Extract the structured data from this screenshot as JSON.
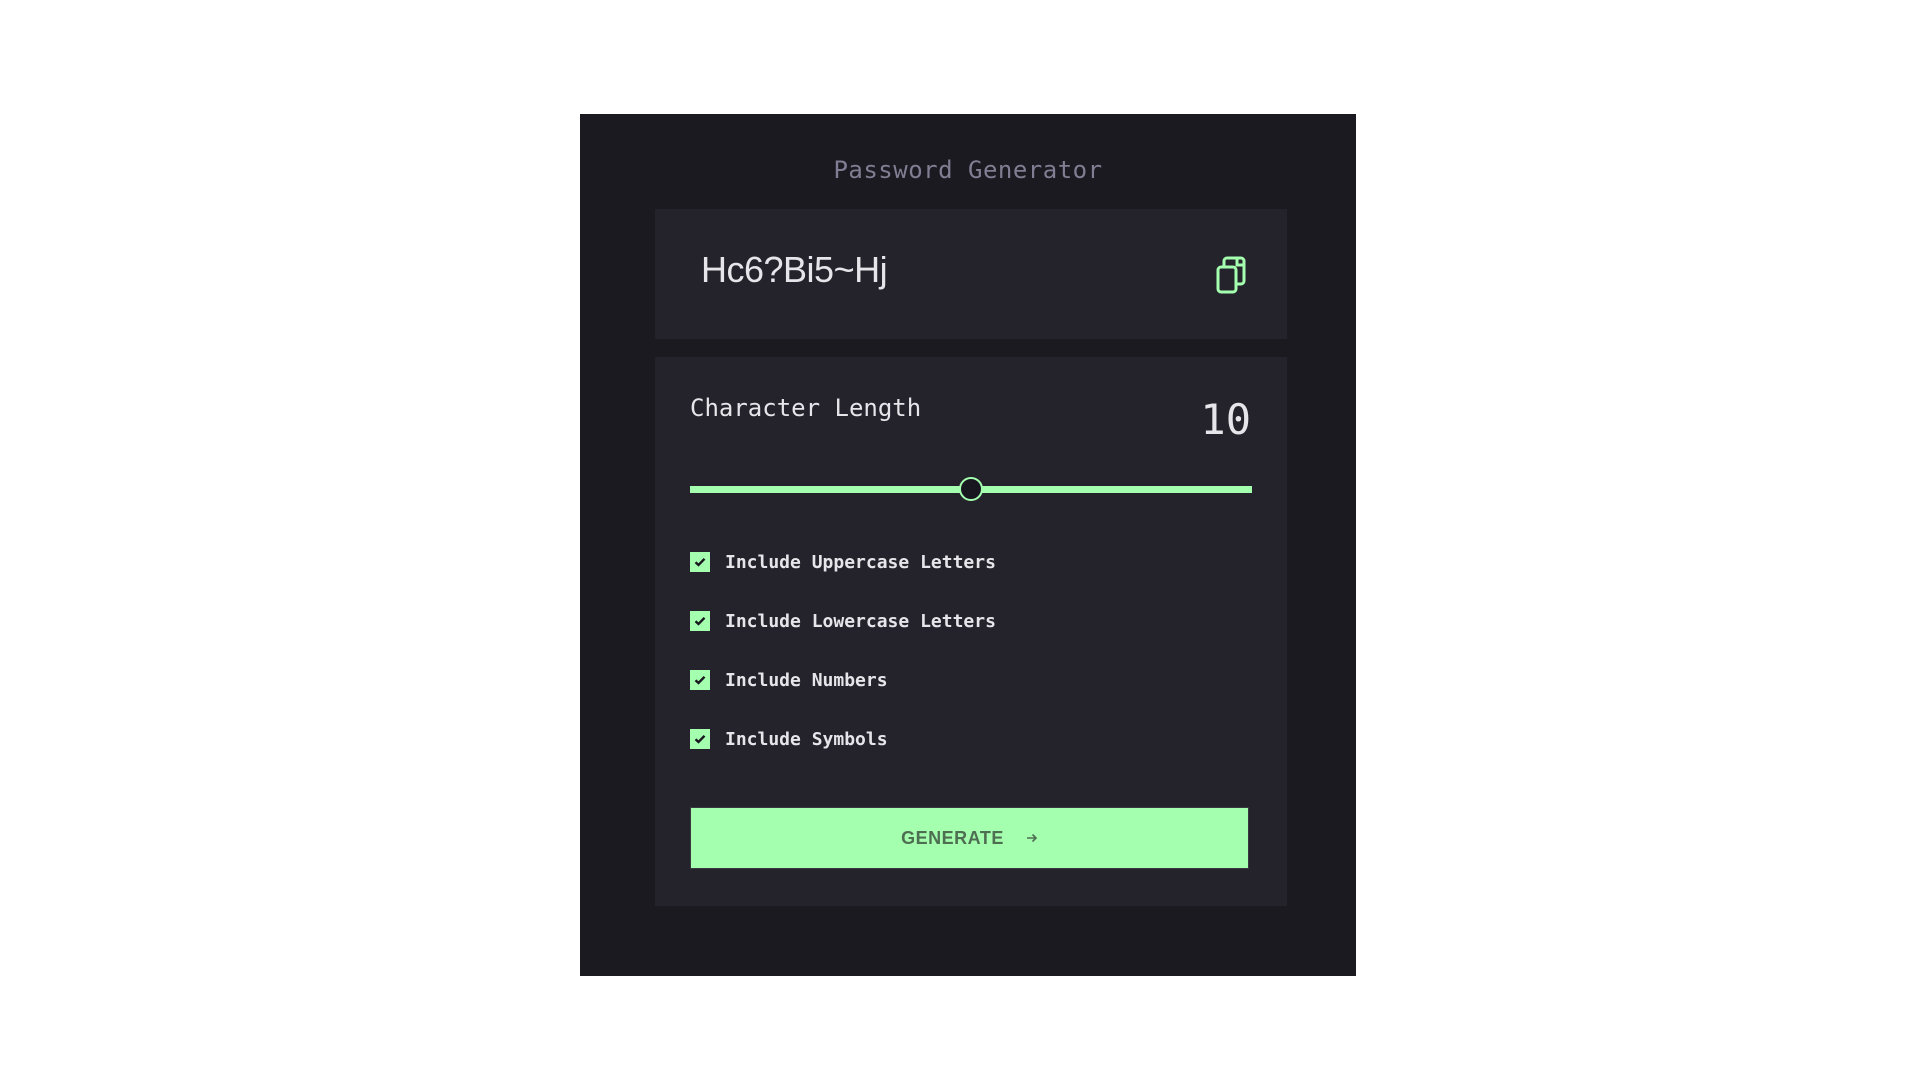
{
  "app": {
    "title": "Password Generator"
  },
  "password": {
    "value": "Hc6?Bi5~Hj",
    "copy_icon": "copy-icon"
  },
  "length": {
    "label": "Character Length",
    "value": "10",
    "slider_fraction": 0.5
  },
  "options": [
    {
      "label": "Include Uppercase Letters",
      "checked": true
    },
    {
      "label": "Include Lowercase Letters",
      "checked": true
    },
    {
      "label": "Include Numbers",
      "checked": true
    },
    {
      "label": "Include Symbols",
      "checked": true
    }
  ],
  "generate": {
    "label": "GENERATE",
    "icon": "arrow-right-icon"
  },
  "colors": {
    "background": "#1b1a21",
    "panel": "#24232c",
    "accent": "#a4ffaf",
    "text": "#e6e5ea",
    "muted": "#817d92"
  }
}
